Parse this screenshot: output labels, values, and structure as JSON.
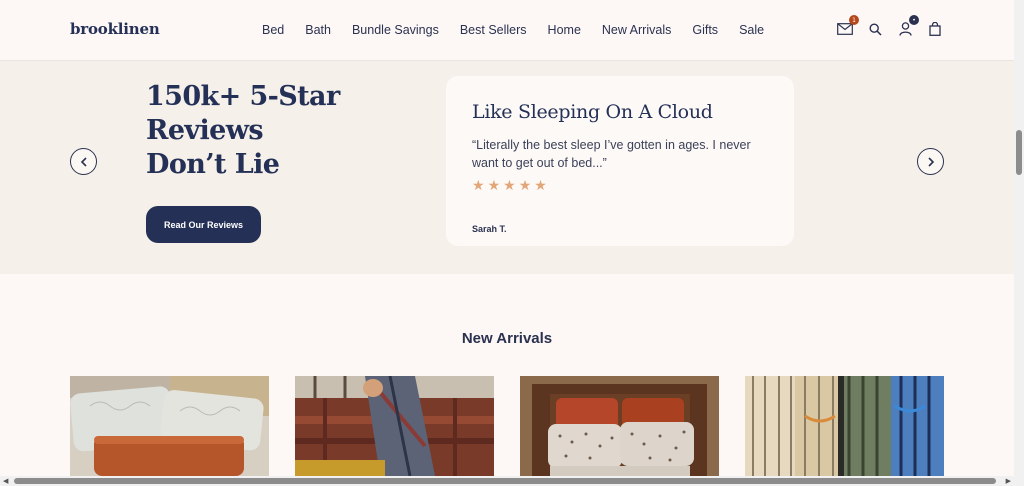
{
  "brand": {
    "logo": "brooklinen",
    "primary": "#243056",
    "star_color": "#e2a679"
  },
  "nav": {
    "items": [
      "Bed",
      "Bath",
      "Bundle Savings",
      "Best Sellers",
      "Home",
      "New Arrivals",
      "Gifts",
      "Sale"
    ]
  },
  "header_icons": {
    "mail_icon": "mail-icon",
    "mail_badge": "1",
    "search_icon": "search-icon",
    "account_icon": "account-icon",
    "account_badge": "•",
    "cart_icon": "bag-icon"
  },
  "reviews": {
    "heading_lines": [
      "150k+ 5-Star",
      "Reviews",
      "Don’t Lie"
    ],
    "button_label": "Read Our Reviews",
    "card": {
      "title": "Like Sleeping On A Cloud",
      "quote": "“Literally the best sleep I’ve gotten in ages. I never want to get out of bed...”",
      "rating": 5,
      "author": "Sarah T."
    }
  },
  "new_arrivals": {
    "title": "New Arrivals",
    "products": [
      "pillows-product-image",
      "plaid-blanket-product-image",
      "bed-pillows-product-image",
      "striped-robes-product-image"
    ]
  }
}
